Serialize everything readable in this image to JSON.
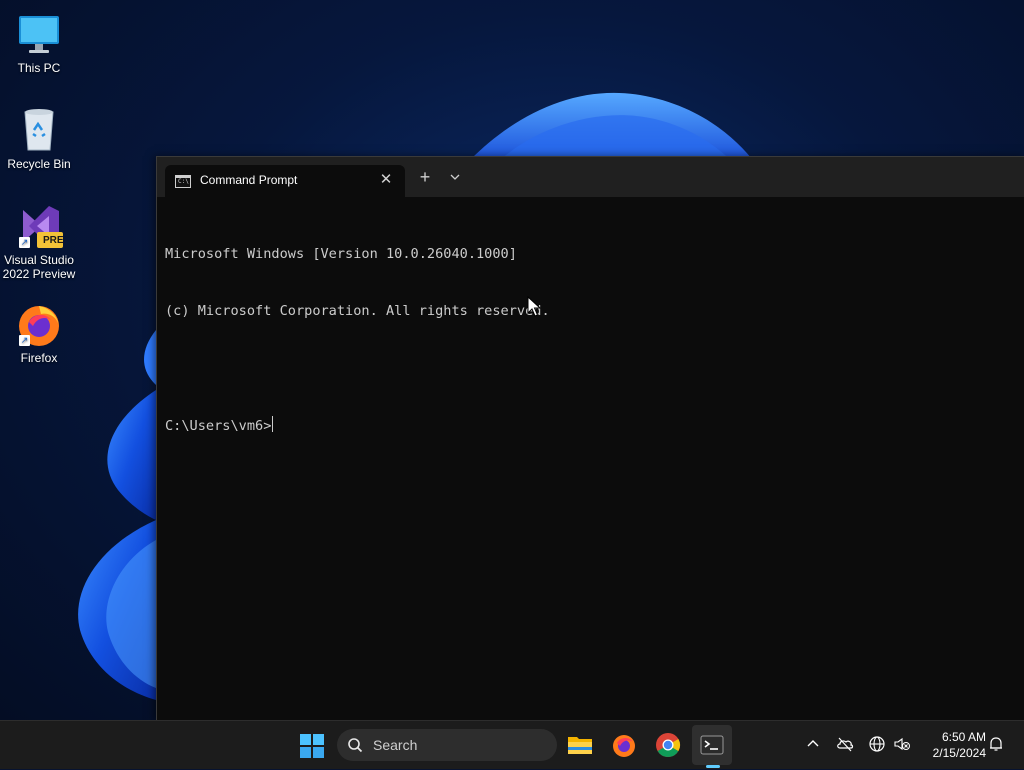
{
  "desktop_icons": [
    {
      "label": "This PC",
      "icon": "computer-icon"
    },
    {
      "label": "Recycle Bin",
      "icon": "recycle-bin-icon"
    },
    {
      "label": "Visual Studio 2022 Preview",
      "icon": "visual-studio-icon",
      "badge": "PRE"
    },
    {
      "label": "Firefox",
      "icon": "firefox-icon"
    }
  ],
  "terminal": {
    "tab_title": "Command Prompt",
    "tab_icon": "cmd-icon",
    "tab_icon_text": "C:\\",
    "close_label": "✕",
    "new_tab_label": "+",
    "lines": [
      "Microsoft Windows [Version 10.0.26040.1000]",
      "(c) Microsoft Corporation. All rights reserved.",
      "",
      "C:\\Users\\vm6>"
    ]
  },
  "taskbar": {
    "search_placeholder": "Search",
    "apps": [
      "start-icon",
      "file-explorer-icon",
      "firefox-icon",
      "chrome-icon",
      "terminal-icon"
    ],
    "active_app": "terminal-icon",
    "accent_color": "#60cdff"
  },
  "tray": {
    "time": "6:50 AM",
    "date": "2/15/2024",
    "icons": [
      "chevron-up-icon",
      "onedrive-offline-icon",
      "network-icon",
      "volume-muted-icon",
      "notification-bell-icon"
    ]
  },
  "colors": {
    "console_background": "#0c0c0c",
    "console_text": "#cccccc",
    "taskbar_background": "#1c1c1c"
  }
}
